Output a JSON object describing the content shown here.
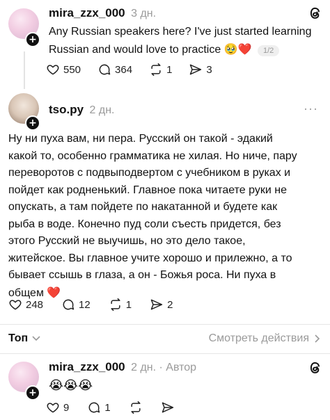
{
  "post1": {
    "username": "mira_zzx_000",
    "time": "3 дн.",
    "line1": "Any Russian speakers here? I've just started learning",
    "line2": "Russian and would love to practice",
    "emoji": "🥹❤️",
    "pager": "1/2",
    "likes": "550",
    "comments": "364",
    "reposts": "1",
    "shares": "3"
  },
  "reply1": {
    "username": "tso.py",
    "time": "2 дн.",
    "more": "···",
    "lines": [
      "Ну ни пуха вам, ни пера. Русский он такой - эдакий",
      "какой то, особенно грамматика не хилая. Но ниче, пару",
      "переворотов с подвыподвертом с учебником в руках и",
      "пойдет как родненький. Главное пока читаете руки не",
      "опускать, а там пойдете по накатанной и будете как",
      "рыба в воде. Конечно пуд соли съесть придется, без",
      "этого Русский не выучишь, но это дело такое,",
      "житейское. Вы главное учите хорошо и прилежно, а то",
      "бывает ссышь в глаза, а он - Божья роса. Ни пуха в",
      "общем"
    ],
    "heart": "❤️",
    "likes": "248",
    "comments": "12",
    "reposts": "1",
    "shares": "2"
  },
  "sort": {
    "label": "Топ",
    "view_activity": "Смотреть действия"
  },
  "reply2": {
    "username": "mira_zzx_000",
    "time": "2 дн.",
    "dot": "·",
    "author": "Автор",
    "emoji": "😭😭😭",
    "likes": "9",
    "comments": "1"
  },
  "colors": {
    "heart": "#e0245e",
    "muted": "#9a9a9a"
  }
}
